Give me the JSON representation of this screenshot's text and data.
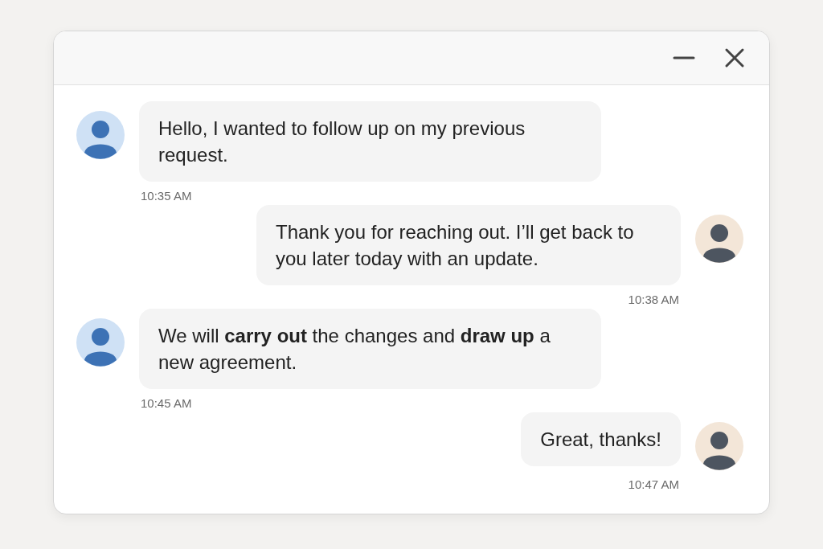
{
  "messages": [
    {
      "kind": "incoming",
      "text": "Hello, I wanted to follow up on my previous request.",
      "time": "10:35 AM"
    },
    {
      "kind": "outgoing",
      "text": "Thank you for reaching out. I’ll get back to you later today with an update.",
      "time": "10:38 AM"
    },
    {
      "kind": "incoming",
      "text": "We will **carry out** the changes and **draw up** a new agreement.",
      "time": "10:45 AM"
    },
    {
      "kind": "outgoing",
      "text": "Great, thanks!",
      "time": "10:47 AM"
    }
  ]
}
